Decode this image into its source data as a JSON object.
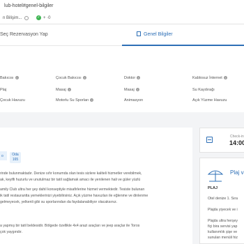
{
  "browser": {
    "address": "lub-hotel#genel-bilgiler",
    "info_left": "n Bilişim...",
    "info_right": "+"
  },
  "tabs": [
    {
      "label": "Seç Rezervasyon Yap",
      "active": false
    },
    {
      "label": "Genel Bilgiler",
      "active": true
    }
  ],
  "accent_color": "#2d6fb6",
  "amenities": {
    "col1": [
      "Bakıcısı",
      "Plaj",
      "Çocuk Havuzu"
    ],
    "col2": [
      "Çocuk Bakıcısı",
      "Masaj",
      "Motorlu Su Sporları"
    ],
    "col3": [
      "Doktor",
      "Masaj",
      "Animasyon"
    ],
    "col4": [
      "Kablosuz İnternet",
      "Su Kaydırağı",
      "Açık Yüzme Havuzu"
    ]
  },
  "room": {
    "label": "Oda",
    "count": "165",
    "badge": "o"
  },
  "description": [
    "rinde bulunmaktadır. Denize sıfır konumda olan tesis sizlere kaliteli hizmetler verebilmek,",
    "ak, keyifli huzurlu ve unutulmaz bir tatil sağlamak amacı ile yenilenen hali ve güler yüzlü",
    "amily Club ultra her şey dahil konseptiyle misafirlerine hizmet vermektedir. Tesiste bulunan",
    "ik tatil restaurantta yemeklerinizi yiyebilirsiniz. Açık yüzme havuzları ile eğlenme ve dinlenme",
    "gelmeyecek, yelkenli gibi su sporlarından da faydalanabiliyor olacaksınız.",
    "a yapmış bir tatil beldesidir. Bölgede özellikle 4x4 arazi araçları ve jeep araçlar ile Toros",
    "çok yaygındır."
  ],
  "checkin": {
    "label": "Check-in",
    "time": "14:00"
  },
  "beach": {
    "title": "Plaj v",
    "heading": "PLAJ",
    "lines": [
      "Otel denize 1. Sıra",
      "Plajda yiyecek ve i",
      "Plajda ultra herşey",
      "fiçi bira servisi yap",
      "kullanımlık şişe ve",
      "sunulan menüli hiz"
    ]
  }
}
